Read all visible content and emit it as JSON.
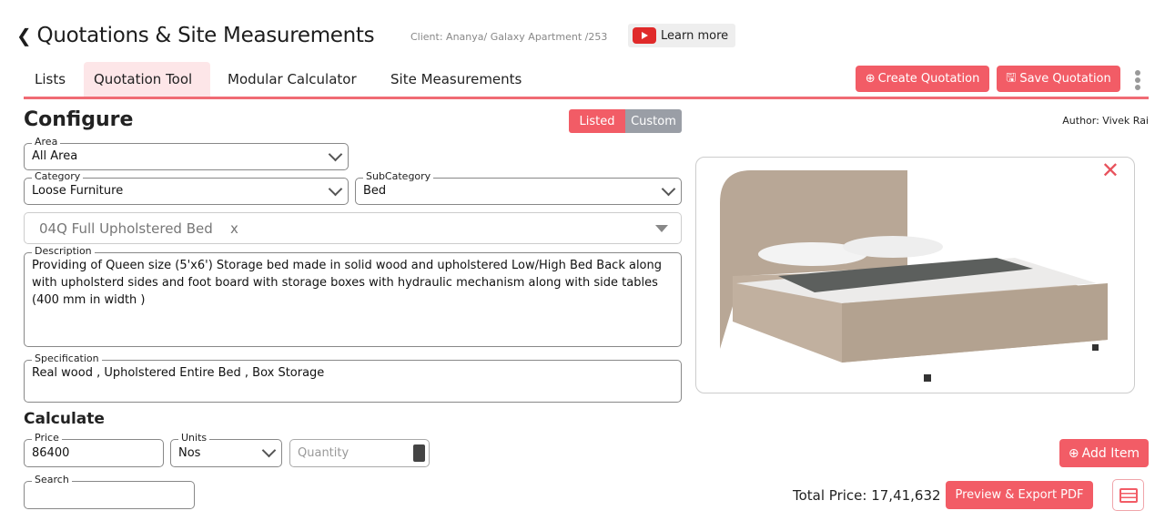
{
  "header": {
    "back_icon": "chevron-left-icon",
    "title": "Quotations & Site Measurements",
    "client": "Client: Ananya/ Galaxy Apartment /253",
    "learn_more": "Learn more"
  },
  "tabs": [
    {
      "label": "Lists"
    },
    {
      "label": "Quotation Tool",
      "active": true
    },
    {
      "label": "Modular Calculator"
    },
    {
      "label": "Site Measurements"
    }
  ],
  "actions": {
    "create": "Create Quotation",
    "save": "Save Quotation"
  },
  "configure": {
    "title": "Configure",
    "toggle": [
      "Listed",
      "Custom"
    ],
    "toggle_active": "Listed",
    "author": "Author: Vivek Rai",
    "area": {
      "label": "Area",
      "value": "All Area"
    },
    "category": {
      "label": "Category",
      "value": "Loose Furniture"
    },
    "subcategory": {
      "label": "SubCategory",
      "value": "Bed"
    },
    "product": {
      "value": "04Q Full Upholstered Bed",
      "clear": "x"
    },
    "description": {
      "label": "Description",
      "value": "Providing of Queen size (5'x6') Storage bed made in solid wood  and upholstered Low/High Bed Back along with upholsterd sides and foot board with storage boxes with  hydraulic mechanism along with side tables (400 mm in width )"
    },
    "specification": {
      "label": "Specification",
      "value": "Real wood , Upholstered Entire Bed ,  Box Storage"
    }
  },
  "calculate": {
    "title": "Calculate",
    "price": {
      "label": "Price",
      "value": "86400"
    },
    "units": {
      "label": "Units",
      "value": "Nos"
    },
    "quantity": {
      "placeholder": "Quantity"
    },
    "search": {
      "label": "Search",
      "value": ""
    }
  },
  "footer": {
    "add_item": "Add Item",
    "total": "Total Price: 17,41,632",
    "export": "Preview & Export PDF"
  },
  "colors": {
    "accent": "#f25c66",
    "muted": "#9a9ea6"
  }
}
